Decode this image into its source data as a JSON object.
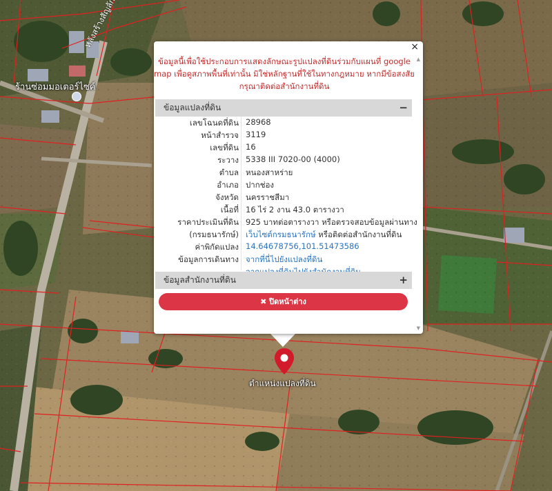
{
  "map": {
    "place_label": "ร้านซ่อมมอเตอร์ไซค์",
    "road_label": "หลังสร้างสัญลักษณ์",
    "pin_label": "ตำแหน่งแปลงที่ดิน",
    "colors": {
      "parcel_line": "#e02020",
      "pin": "#d11a2a"
    }
  },
  "popup": {
    "close_icon": "×",
    "notice": "ข้อมูลนี้เพื่อใช้ประกอบการแสดงลักษณะรูปแปลงที่ดินร่วมกับแผนที่ google map เพื่อดูสภาพพื้นที่เท่านั้น มิใช่หลักฐานที่ใช้ในทางกฎหมาย หากมีข้อสงสัย กรุณาติดต่อสำนักงานที่ดิน",
    "section1": {
      "title": "ข้อมูลแปลงที่ดิน",
      "toggle": "−"
    },
    "rows": [
      {
        "label": "เลขโฉนดที่ดิน",
        "value": "28968"
      },
      {
        "label": "หน้าสำรวจ",
        "value": "3119"
      },
      {
        "label": "เลขที่ดิน",
        "value": "16"
      },
      {
        "label": "ระวาง",
        "value": "5338 III 7020-00 (4000)"
      },
      {
        "label": "ตำบล",
        "value": "หนองสาหร่าย"
      },
      {
        "label": "อำเภอ",
        "value": "ปากช่อง"
      },
      {
        "label": "จังหวัด",
        "value": "นครราชสีมา"
      },
      {
        "label": "เนื้อที่",
        "value": "16 ไร่ 2 งาน 43.0 ตารางวา"
      }
    ],
    "price": {
      "label": "ราคาประเมินที่ดิน",
      "label2": "(กรมธนารักษ์)",
      "value": "925 บาทต่อตารางวา หรือตรวจสอบข้อมูลผ่านทาง",
      "link": "เว็บไซต์กรมธนารักษ์",
      "suffix": " หรือติดต่อสำนักงานที่ดิน"
    },
    "coords": {
      "label": "ค่าพิกัดแปลง",
      "value": "14.64678756,101.51473586"
    },
    "directions": {
      "label": "ข้อมูลการเดินทาง",
      "link1": "จากที่นี่ไปยังแปลงที่ดิน",
      "link2": "จากแปลงที่ดินไปยังสำนักงานที่ดิน"
    },
    "section2": {
      "title": "ข้อมูลสำนักงานที่ดิน",
      "toggle": "+"
    },
    "close_button": {
      "icon": "✖",
      "label": "ปิดหน้าต่าง"
    }
  }
}
